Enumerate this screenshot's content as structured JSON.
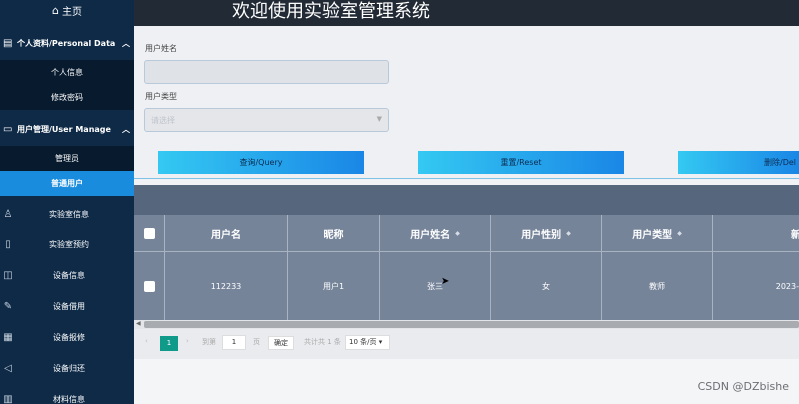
{
  "sidebar": {
    "home": "主页",
    "group1": {
      "label": "个人资料/Personal Data",
      "items": [
        "个人信息",
        "修改密码"
      ]
    },
    "group2": {
      "label": "用户管理/User Manage",
      "items": [
        "管理员",
        "普通用户"
      ]
    },
    "nav": [
      "实验室信息",
      "实验室预约",
      "设备信息",
      "设备借用",
      "设备报修",
      "设备归还",
      "材料信息"
    ]
  },
  "header": {
    "title": "欢迎使用实验室管理系统"
  },
  "form": {
    "name_label": "用户姓名",
    "name_value": "",
    "type_label": "用户类型",
    "type_placeholder": "请选择",
    "query": "查询/Query",
    "reset": "重置/Reset",
    "delete": "删除/Del"
  },
  "table": {
    "columns": [
      "用户名",
      "昵称",
      "用户姓名",
      "用户性别",
      "用户类型",
      "新"
    ],
    "rows": [
      {
        "username": "112233",
        "nickname": "用户1",
        "realname": "张三",
        "gender": "女",
        "type": "教师",
        "time": "2023-"
      }
    ]
  },
  "pager": {
    "current": "1",
    "goto_label": "到第",
    "goto_value": "1",
    "page_unit": "页",
    "confirm": "确定",
    "total": "共计共 1 条",
    "page_size": "10 条/页"
  },
  "watermark": "CSDN @DZbishe",
  "colors": {
    "sidebar": "#0e2a47",
    "active": "#1a8cde",
    "button_start": "#34c9f2",
    "button_end": "#1a86e6",
    "pager_active": "#109a8a"
  }
}
